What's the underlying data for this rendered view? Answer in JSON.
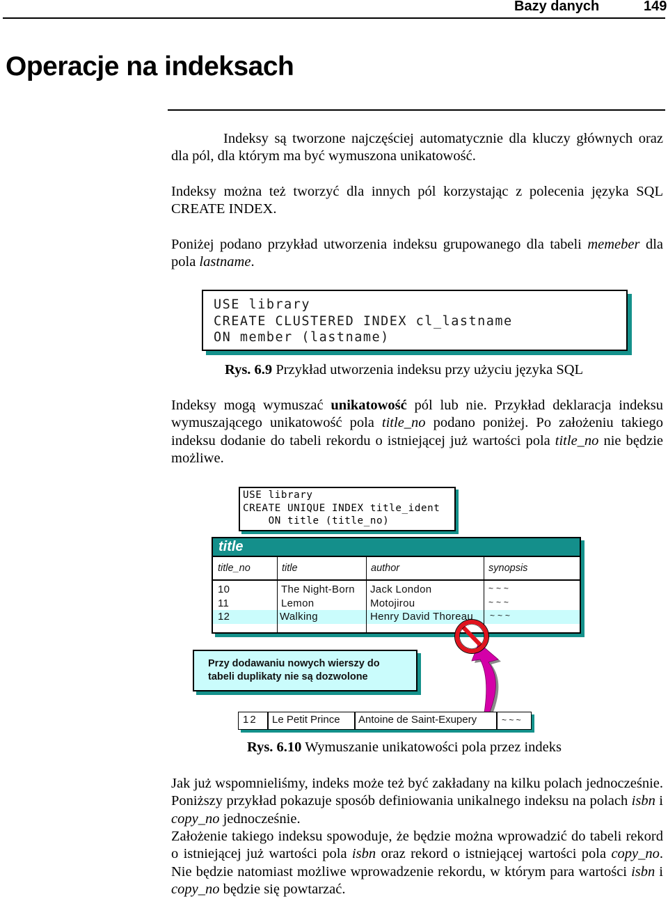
{
  "header": {
    "section": "Bazy danych",
    "page_number": "149"
  },
  "title": "Operacje na indeksach",
  "paragraphs": {
    "p1": "Indeksy są tworzone najczęściej automatycznie dla kluczy głównych oraz dla pól, dla którym ma być wymuszona unikatowość.",
    "p2": "Indeksy można też tworzyć dla innych pól korzystając z polecenia języka SQL CREATE INDEX.",
    "p3_a": "Poniżej podano przykład utworzenia indeksu grupowanego dla tabeli ",
    "p3_table": "memeber",
    "p3_b": " dla pola ",
    "p3_field": "lastname",
    "p3_c": ".",
    "p4_a": "Indeksy mogą wymuszać ",
    "p4_bold": "unikatowość",
    "p4_b": " pól lub nie. Przykład deklaracja indeksu wymuszającego unikatowość pola ",
    "p4_field1": "title_no",
    "p4_c": " podano poniżej. Po założeniu takiego indeksu dodanie do tabeli rekordu o istniejącej już wartości pola ",
    "p4_field2": "title_no",
    "p4_d": " nie będzie możliwe.",
    "p5_a": "Jak już wspomnieliśmy, indeks może też być zakładany na kilku polach jednocześnie. Poniższy przykład pokazuje sposób definiowania unikalnego indeksu na polach ",
    "p5_isbn": "isbn",
    "p5_b": " i ",
    "p5_copy": "copy_no",
    "p5_c": " jednocześnie.",
    "p6_a": "Założenie takiego indeksu spowoduje, że będzie można wprowadzić do tabeli rekord o istniejącej już wartości pola ",
    "p6_isbn": "isbn",
    "p6_b": " oraz rekord o istniejącej wartości pola ",
    "p6_copy": "copy_no",
    "p6_c": ". Nie będzie natomiast możliwe wprowadzenie rekordu, w którym para wartości ",
    "p6_isbn2": "isbn",
    "p6_d": " i ",
    "p6_copy2": "copy_no",
    "p6_e": " będzie się powtarzać."
  },
  "figure1": {
    "code_lines": [
      "USE library",
      "CREATE CLUSTERED INDEX cl_lastname",
      "ON member (lastname)"
    ],
    "caption_label": "Rys. 6.9",
    "caption_text": " Przykład utworzenia indeksu przy użyciu języka SQL"
  },
  "figure2": {
    "code_lines": [
      "USE library",
      "CREATE UNIQUE INDEX title_ident",
      "    ON title (title_no)"
    ],
    "table": {
      "name": "title",
      "columns": [
        "title_no",
        "title",
        "author",
        "synopsis"
      ],
      "rows": [
        [
          "10",
          "The Night-Born",
          "Jack London",
          "~ ~ ~"
        ],
        [
          "11",
          "Lemon",
          "Motojirou",
          "~ ~ ~"
        ],
        [
          "12",
          "Walking",
          "Henry David Thoreau",
          "~ ~ ~"
        ]
      ]
    },
    "note": [
      "Przy dodawaniu nowych wierszy do",
      "tabeli duplikaty nie są dozwolone"
    ],
    "new_row": [
      "12",
      "Le Petit Prince",
      "Antoine de Saint-Exupery",
      "~ ~ ~"
    ],
    "caption_label": "Rys. 6.10",
    "caption_text": " Wymuszanie unikatowości pola przez indeks"
  },
  "colors": {
    "teal": "#148f8b",
    "highlight": "#cafcfc",
    "arrow": "#d400a8",
    "prohibited": "#e0141e"
  }
}
